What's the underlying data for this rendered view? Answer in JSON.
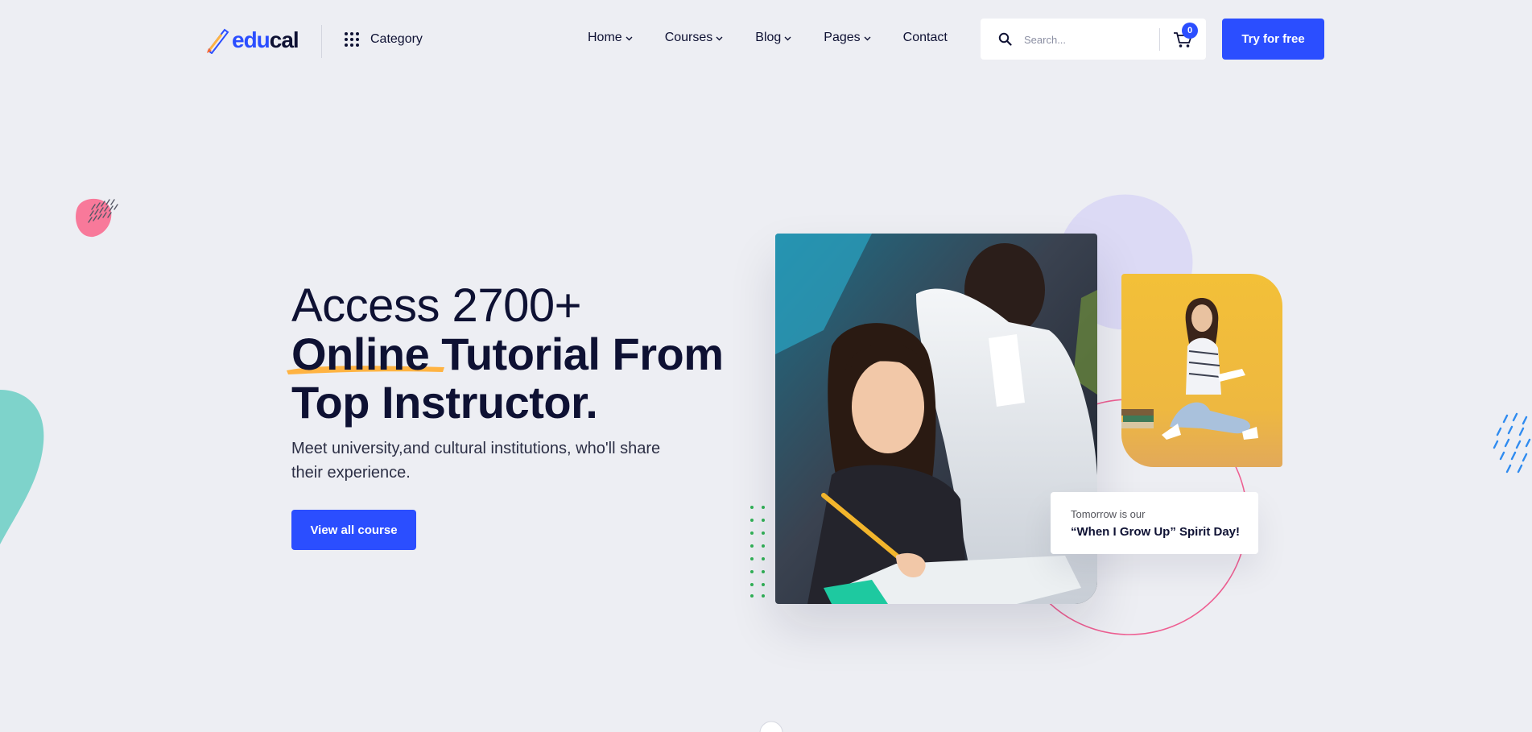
{
  "brand": {
    "logo_part1": "edu",
    "logo_part2": "cal",
    "accent": "#2b4eff",
    "dark": "#0e1133"
  },
  "header": {
    "category_label": "Category",
    "nav": [
      {
        "label": "Home",
        "has_dropdown": true
      },
      {
        "label": "Courses",
        "has_dropdown": true
      },
      {
        "label": "Blog",
        "has_dropdown": true
      },
      {
        "label": "Pages",
        "has_dropdown": true
      },
      {
        "label": "Contact",
        "has_dropdown": false
      }
    ],
    "search_placeholder": "Search...",
    "cart_count": "0",
    "cta_label": "Try for free"
  },
  "hero": {
    "title_line1": "Access 2700+",
    "title_highlight": "Online",
    "title_line2_rest": " Tutorial From",
    "title_line3": "Top Instructor.",
    "subtitle": "Meet university,and cultural institutions, who'll share their experience.",
    "button_label": "View all course",
    "highlight_color": "#ffb342"
  },
  "event_card": {
    "line1": "Tomorrow is our",
    "line2": "“When I Grow Up” Spirit Day!"
  },
  "decor_colors": {
    "pink_blob": "#f8799a",
    "teal_blob": "#7ed3cb",
    "lavender_circle": "#dcdaf5",
    "pink_ring": "#ee5f92",
    "green_dots": "#31b157",
    "blue_dashes": "#2f8bf0"
  }
}
